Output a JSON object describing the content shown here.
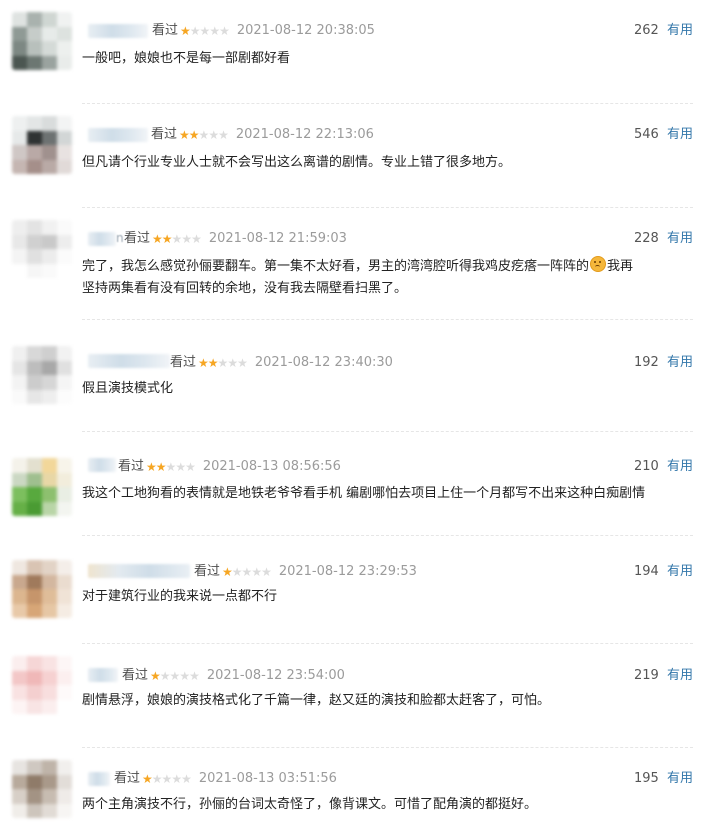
{
  "reviews": [
    {
      "watched_label": "看过",
      "rating": 1,
      "time": "2021-08-12 20:38:05",
      "votes": "262",
      "useful_label": "有用",
      "content": "一般吧，娘娘也不是每一部剧都好看",
      "name_tail": ""
    },
    {
      "watched_label": "看过",
      "rating": 2,
      "time": "2021-08-12 22:13:06",
      "votes": "546",
      "useful_label": "有用",
      "content": "但凡请个行业专业人士就不会写出这么离谱的剧情。专业上错了很多地方。",
      "name_tail": ""
    },
    {
      "watched_label": "看过",
      "rating": 2,
      "time": "2021-08-12 21:59:03",
      "votes": "228",
      "useful_label": "有用",
      "content_before_emoji": "完了，我怎么感觉孙俪要翻车。第一集不太好看，男主的湾湾腔听得我鸡皮疙瘩一阵阵的",
      "content_after_emoji": "我再坚持两集看有没有回转的余地，没有我去隔壁看扫黑了。",
      "name_tail": "n"
    },
    {
      "watched_label": "看过",
      "rating": 2,
      "time": "2021-08-12 23:40:30",
      "votes": "192",
      "useful_label": "有用",
      "content": "假且演技模式化",
      "name_tail": ""
    },
    {
      "watched_label": "看过",
      "rating": 2,
      "time": "2021-08-13 08:56:56",
      "votes": "210",
      "useful_label": "有用",
      "content": "我这个工地狗看的表情就是地铁老爷爷看手机 编剧哪怕去项目上住一个月都写不出来这种白痴剧情",
      "name_tail": ""
    },
    {
      "watched_label": "看过",
      "rating": 1,
      "time": "2021-08-12 23:29:53",
      "votes": "194",
      "useful_label": "有用",
      "content": "对于建筑行业的我来说一点都不行",
      "name_tail": ""
    },
    {
      "watched_label": "看过",
      "rating": 1,
      "time": "2021-08-12 23:54:00",
      "votes": "219",
      "useful_label": "有用",
      "content": "剧情悬浮，娘娘的演技格式化了千篇一律，赵又廷的演技和脸都太赶客了，可怕。",
      "name_tail": ""
    },
    {
      "watched_label": "看过",
      "rating": 1,
      "time": "2021-08-13 03:51:56",
      "votes": "195",
      "useful_label": "有用",
      "content": "两个主角演技不行，孙俪的台词太奇怪了，像背课文。可惜了配角演的都挺好。",
      "name_tail": ""
    }
  ],
  "colors": {
    "star_on": "#f6a623",
    "star_off": "#dcdcdc",
    "link": "#3377aa",
    "timestamp": "#9b9b9b"
  }
}
